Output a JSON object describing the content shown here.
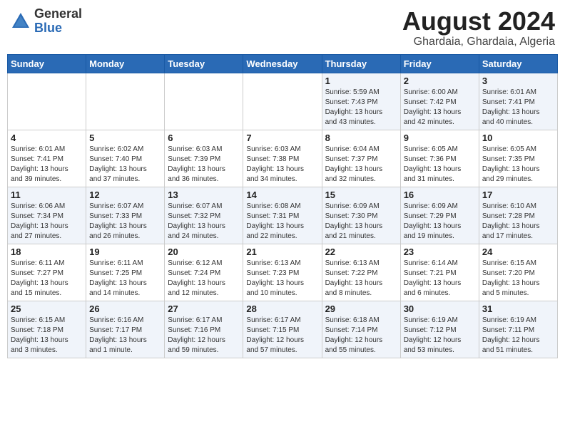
{
  "header": {
    "logo_general": "General",
    "logo_blue": "Blue",
    "month_year": "August 2024",
    "location": "Ghardaia, Ghardaia, Algeria"
  },
  "weekdays": [
    "Sunday",
    "Monday",
    "Tuesday",
    "Wednesday",
    "Thursday",
    "Friday",
    "Saturday"
  ],
  "weeks": [
    [
      {
        "day": "",
        "info": ""
      },
      {
        "day": "",
        "info": ""
      },
      {
        "day": "",
        "info": ""
      },
      {
        "day": "",
        "info": ""
      },
      {
        "day": "1",
        "info": "Sunrise: 5:59 AM\nSunset: 7:43 PM\nDaylight: 13 hours\nand 43 minutes."
      },
      {
        "day": "2",
        "info": "Sunrise: 6:00 AM\nSunset: 7:42 PM\nDaylight: 13 hours\nand 42 minutes."
      },
      {
        "day": "3",
        "info": "Sunrise: 6:01 AM\nSunset: 7:41 PM\nDaylight: 13 hours\nand 40 minutes."
      }
    ],
    [
      {
        "day": "4",
        "info": "Sunrise: 6:01 AM\nSunset: 7:41 PM\nDaylight: 13 hours\nand 39 minutes."
      },
      {
        "day": "5",
        "info": "Sunrise: 6:02 AM\nSunset: 7:40 PM\nDaylight: 13 hours\nand 37 minutes."
      },
      {
        "day": "6",
        "info": "Sunrise: 6:03 AM\nSunset: 7:39 PM\nDaylight: 13 hours\nand 36 minutes."
      },
      {
        "day": "7",
        "info": "Sunrise: 6:03 AM\nSunset: 7:38 PM\nDaylight: 13 hours\nand 34 minutes."
      },
      {
        "day": "8",
        "info": "Sunrise: 6:04 AM\nSunset: 7:37 PM\nDaylight: 13 hours\nand 32 minutes."
      },
      {
        "day": "9",
        "info": "Sunrise: 6:05 AM\nSunset: 7:36 PM\nDaylight: 13 hours\nand 31 minutes."
      },
      {
        "day": "10",
        "info": "Sunrise: 6:05 AM\nSunset: 7:35 PM\nDaylight: 13 hours\nand 29 minutes."
      }
    ],
    [
      {
        "day": "11",
        "info": "Sunrise: 6:06 AM\nSunset: 7:34 PM\nDaylight: 13 hours\nand 27 minutes."
      },
      {
        "day": "12",
        "info": "Sunrise: 6:07 AM\nSunset: 7:33 PM\nDaylight: 13 hours\nand 26 minutes."
      },
      {
        "day": "13",
        "info": "Sunrise: 6:07 AM\nSunset: 7:32 PM\nDaylight: 13 hours\nand 24 minutes."
      },
      {
        "day": "14",
        "info": "Sunrise: 6:08 AM\nSunset: 7:31 PM\nDaylight: 13 hours\nand 22 minutes."
      },
      {
        "day": "15",
        "info": "Sunrise: 6:09 AM\nSunset: 7:30 PM\nDaylight: 13 hours\nand 21 minutes."
      },
      {
        "day": "16",
        "info": "Sunrise: 6:09 AM\nSunset: 7:29 PM\nDaylight: 13 hours\nand 19 minutes."
      },
      {
        "day": "17",
        "info": "Sunrise: 6:10 AM\nSunset: 7:28 PM\nDaylight: 13 hours\nand 17 minutes."
      }
    ],
    [
      {
        "day": "18",
        "info": "Sunrise: 6:11 AM\nSunset: 7:27 PM\nDaylight: 13 hours\nand 15 minutes."
      },
      {
        "day": "19",
        "info": "Sunrise: 6:11 AM\nSunset: 7:25 PM\nDaylight: 13 hours\nand 14 minutes."
      },
      {
        "day": "20",
        "info": "Sunrise: 6:12 AM\nSunset: 7:24 PM\nDaylight: 13 hours\nand 12 minutes."
      },
      {
        "day": "21",
        "info": "Sunrise: 6:13 AM\nSunset: 7:23 PM\nDaylight: 13 hours\nand 10 minutes."
      },
      {
        "day": "22",
        "info": "Sunrise: 6:13 AM\nSunset: 7:22 PM\nDaylight: 13 hours\nand 8 minutes."
      },
      {
        "day": "23",
        "info": "Sunrise: 6:14 AM\nSunset: 7:21 PM\nDaylight: 13 hours\nand 6 minutes."
      },
      {
        "day": "24",
        "info": "Sunrise: 6:15 AM\nSunset: 7:20 PM\nDaylight: 13 hours\nand 5 minutes."
      }
    ],
    [
      {
        "day": "25",
        "info": "Sunrise: 6:15 AM\nSunset: 7:18 PM\nDaylight: 13 hours\nand 3 minutes."
      },
      {
        "day": "26",
        "info": "Sunrise: 6:16 AM\nSunset: 7:17 PM\nDaylight: 13 hours\nand 1 minute."
      },
      {
        "day": "27",
        "info": "Sunrise: 6:17 AM\nSunset: 7:16 PM\nDaylight: 12 hours\nand 59 minutes."
      },
      {
        "day": "28",
        "info": "Sunrise: 6:17 AM\nSunset: 7:15 PM\nDaylight: 12 hours\nand 57 minutes."
      },
      {
        "day": "29",
        "info": "Sunrise: 6:18 AM\nSunset: 7:14 PM\nDaylight: 12 hours\nand 55 minutes."
      },
      {
        "day": "30",
        "info": "Sunrise: 6:19 AM\nSunset: 7:12 PM\nDaylight: 12 hours\nand 53 minutes."
      },
      {
        "day": "31",
        "info": "Sunrise: 6:19 AM\nSunset: 7:11 PM\nDaylight: 12 hours\nand 51 minutes."
      }
    ]
  ]
}
